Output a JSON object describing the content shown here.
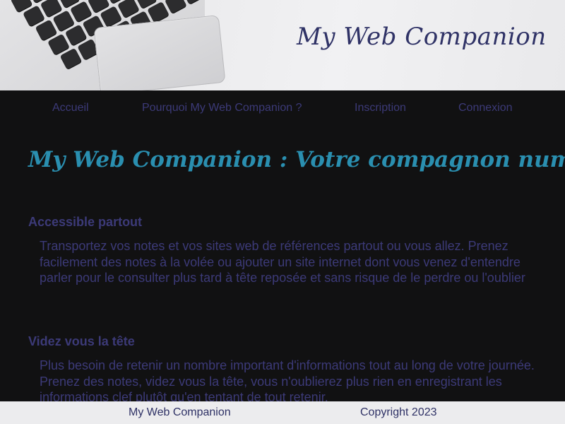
{
  "header": {
    "title": "My Web Companion"
  },
  "nav": {
    "items": [
      {
        "label": "Accueil"
      },
      {
        "label": "Pourquoi My Web Companion ?"
      },
      {
        "label": "Inscription"
      },
      {
        "label": "Connexion"
      }
    ]
  },
  "main": {
    "heading": "My Web Companion : Votre compagnon numérique",
    "sections": [
      {
        "title": "Accessible partout",
        "text": "Transportez vos notes et vos sites web de références partout ou vous allez. Prenez facilement des notes à la volée ou ajouter un site internet dont vous venez d'entendre parler pour le consulter plus tard à tête reposée et sans risque de le perdre ou l'oublier"
      },
      {
        "title": "Videz vous la tête",
        "text": "Plus besoin de retenir un nombre important d'informations tout au long de votre journée. Prenez des notes, videz vous la tête, vous n'oublierez plus rien en enregistrant les informations clef plutôt qu'en tentant de tout retenir."
      }
    ]
  },
  "footer": {
    "brand": "My Web Companion",
    "copyright": "Copyright 2023"
  },
  "colors": {
    "background": "#111112",
    "nav_text": "#3c3a78",
    "heading": "#2a8fb0",
    "banner_title": "#2f3266",
    "footer_bg": "#ececee"
  },
  "icons": {
    "banner_image": "laptop-keyboard-image"
  }
}
